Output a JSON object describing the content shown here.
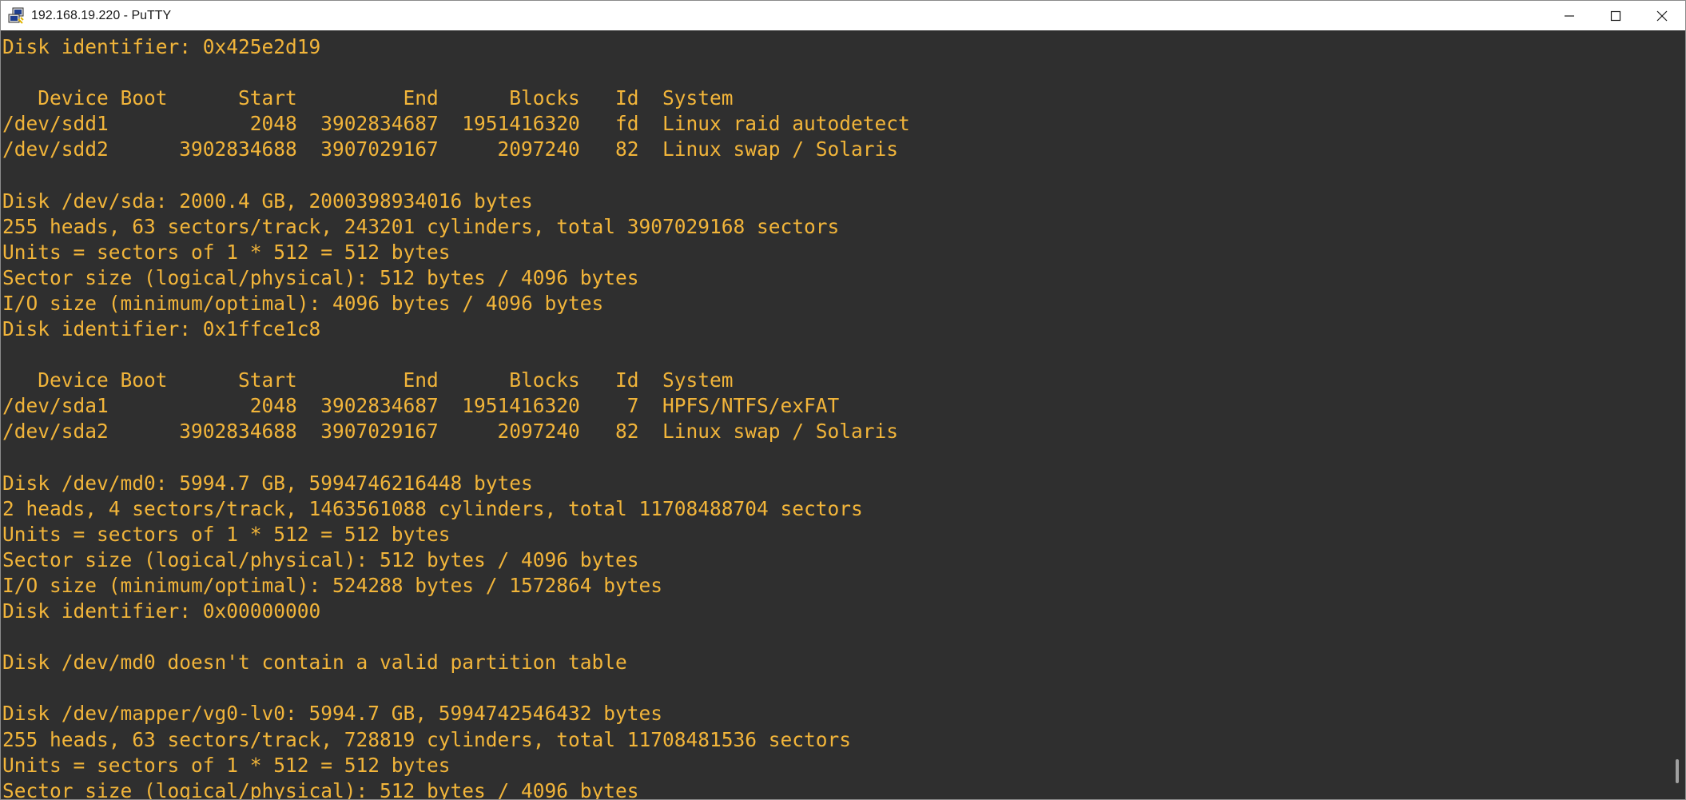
{
  "window": {
    "title": "192.168.19.220 - PuTTY",
    "icon": "putty-icon",
    "controls": [
      "minimize-icon",
      "maximize-icon",
      "close-icon"
    ]
  },
  "terminal": {
    "text_color": "#f2b53a",
    "background": "#2f2f2f",
    "lines": [
      "Disk identifier: 0x425e2d19",
      "",
      "   Device Boot      Start         End      Blocks   Id  System",
      "/dev/sdd1            2048  3902834687  1951416320   fd  Linux raid autodetect",
      "/dev/sdd2      3902834688  3907029167     2097240   82  Linux swap / Solaris",
      "",
      "Disk /dev/sda: 2000.4 GB, 2000398934016 bytes",
      "255 heads, 63 sectors/track, 243201 cylinders, total 3907029168 sectors",
      "Units = sectors of 1 * 512 = 512 bytes",
      "Sector size (logical/physical): 512 bytes / 4096 bytes",
      "I/O size (minimum/optimal): 4096 bytes / 4096 bytes",
      "Disk identifier: 0x1ffce1c8",
      "",
      "   Device Boot      Start         End      Blocks   Id  System",
      "/dev/sda1            2048  3902834687  1951416320    7  HPFS/NTFS/exFAT",
      "/dev/sda2      3902834688  3907029167     2097240   82  Linux swap / Solaris",
      "",
      "Disk /dev/md0: 5994.7 GB, 5994746216448 bytes",
      "2 heads, 4 sectors/track, 1463561088 cylinders, total 11708488704 sectors",
      "Units = sectors of 1 * 512 = 512 bytes",
      "Sector size (logical/physical): 512 bytes / 4096 bytes",
      "I/O size (minimum/optimal): 524288 bytes / 1572864 bytes",
      "Disk identifier: 0x00000000",
      "",
      "Disk /dev/md0 doesn't contain a valid partition table",
      "",
      "Disk /dev/mapper/vg0-lv0: 5994.7 GB, 5994742546432 bytes",
      "255 heads, 63 sectors/track, 728819 cylinders, total 11708481536 sectors",
      "Units = sectors of 1 * 512 = 512 bytes",
      "Sector size (logical/physical): 512 bytes / 4096 bytes"
    ]
  }
}
